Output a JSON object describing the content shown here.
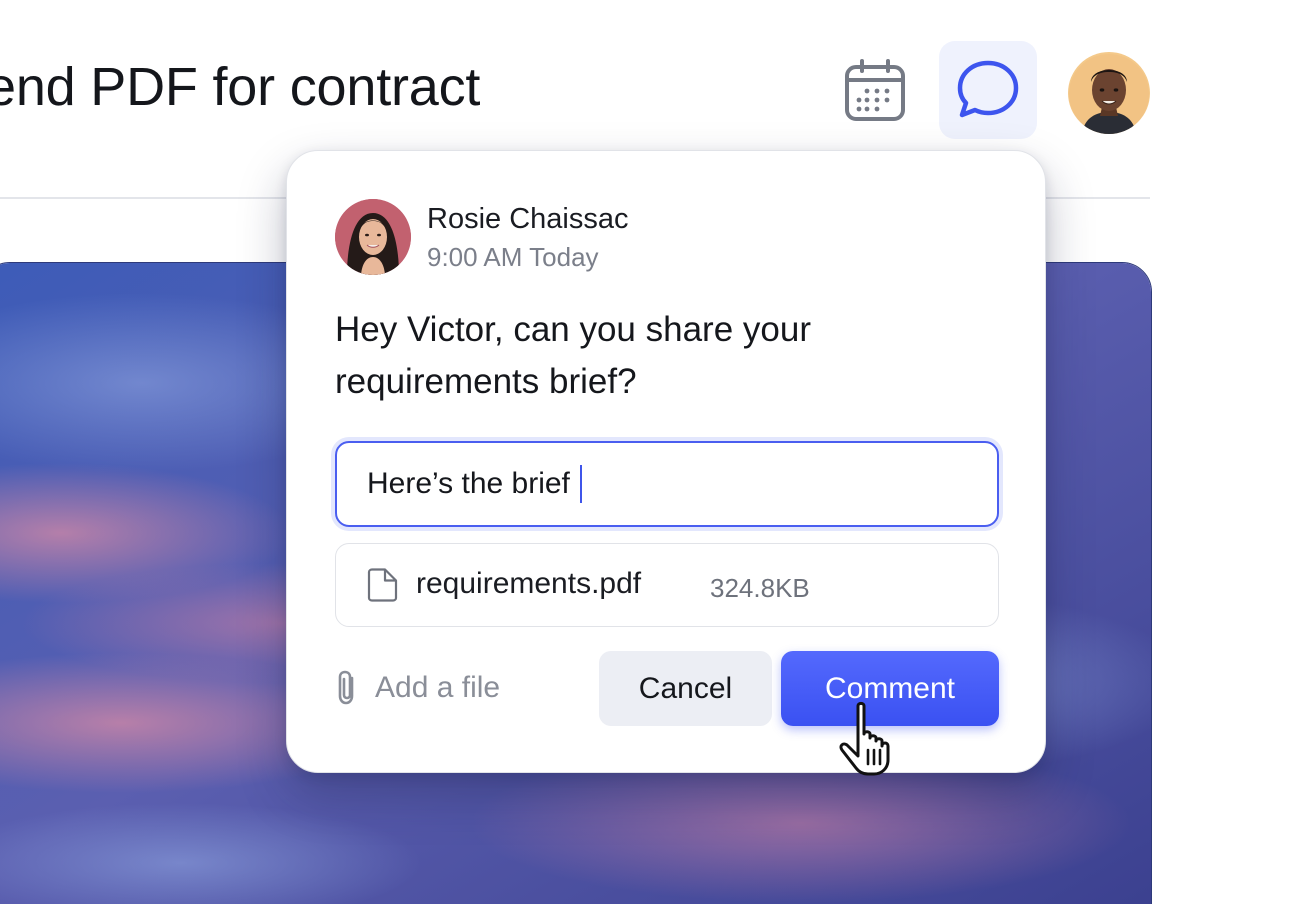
{
  "header": {
    "title": "end PDF for contract",
    "calendar_icon": "calendar-icon",
    "comments_icon": "chat-bubble-icon",
    "user_avatar": "user-avatar"
  },
  "comment_popover": {
    "author": {
      "name": "Rosie Chaissac",
      "timestamp": "9:00 AM Today"
    },
    "message": "Hey Victor, can you share your requirements brief?",
    "reply_input": {
      "value": "Here’s the brief"
    },
    "attachment": {
      "icon": "file-icon",
      "filename": "requirements.pdf",
      "size": "324.8KB"
    },
    "add_file": {
      "icon": "paperclip-icon",
      "label": "Add a file"
    },
    "buttons": {
      "cancel": "Cancel",
      "comment": "Comment"
    }
  },
  "colors": {
    "accent": "#4458F5",
    "accent_light": "#EFF2FD",
    "muted_text": "#7B7F8A",
    "border": "#E1E3E8"
  }
}
